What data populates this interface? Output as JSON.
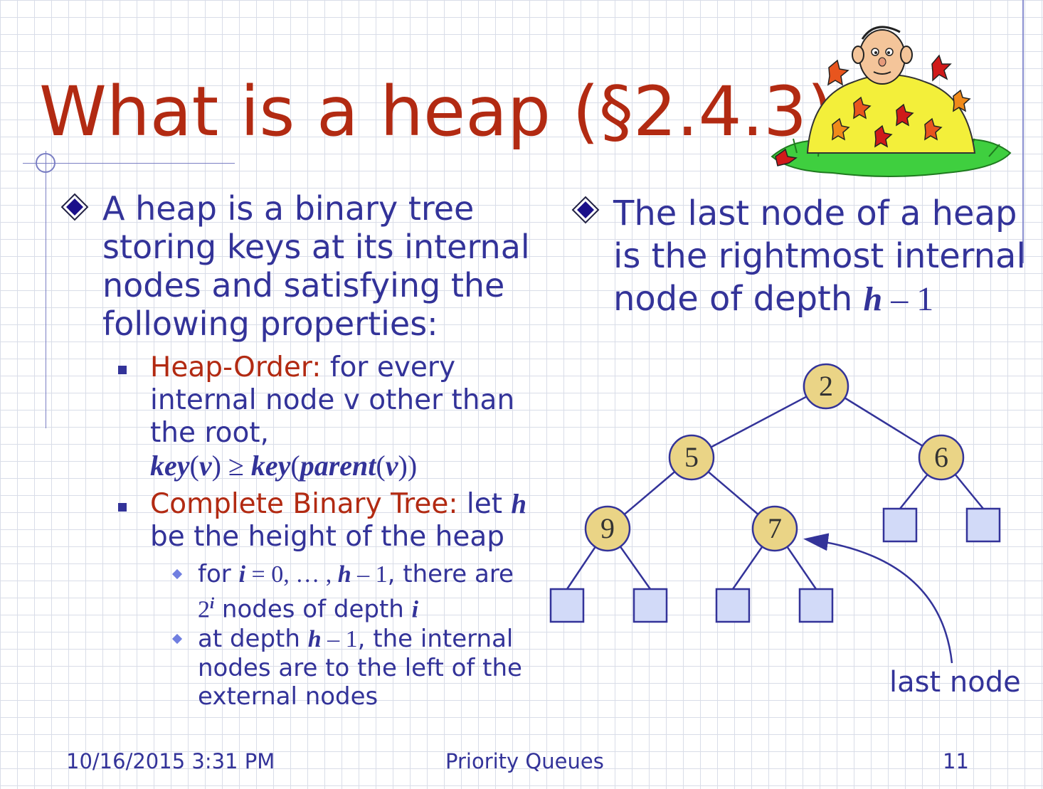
{
  "slide": {
    "title": "What is a heap (§2.4.3)"
  },
  "left": {
    "intro": [
      "A heap is a binary tree",
      "storing keys at its internal",
      "nodes and satisfying the",
      "following properties:"
    ],
    "heap_order": {
      "label": "Heap-Order:",
      "text_after_label": "for every",
      "line2": "internal node v other than",
      "line3": "the root,",
      "formula": {
        "key": "key",
        "lp": "(",
        "v": "v",
        "rp": ")",
        "geq": " ≥ ",
        "key2": "key",
        "lp2": "(",
        "parent": "parent",
        "lp3": "(",
        "v2": "v",
        "rp3": "))"
      }
    },
    "complete": {
      "label": "Complete Binary Tree:",
      "text_after_label": "let",
      "h": "h",
      "line2": "be the height of the heap",
      "sub1": {
        "for": "for",
        "i": "i",
        "eq": " = 0, … , ",
        "h": "h",
        "minus": " – 1",
        "rest": ", there are",
        "two": "2",
        "sup_i": "i",
        "line2_text": " nodes of depth ",
        "i2": "i"
      },
      "sub2": {
        "at_depth": "at depth ",
        "h": "h",
        "minus": " – 1",
        "rest": ", the internal",
        "line2": "nodes are to the left of the",
        "line3": "external nodes"
      }
    }
  },
  "right": {
    "line1": "The last node of a heap",
    "line2": "is the rightmost internal",
    "line3_text": "node of depth ",
    "h": "h",
    "minus": " – 1"
  },
  "tree": {
    "internal_nodes": [
      "2",
      "5",
      "6",
      "9",
      "7"
    ],
    "node_fill": "#ead486",
    "leaf_fill": "#d2daf8",
    "last_node_label": "last node"
  },
  "footer": {
    "date": "10/16/2015 3:31 PM",
    "center": "Priority Queues",
    "page": "11"
  },
  "colors": {
    "title": "#b22a12",
    "body_text": "#333399",
    "accent": "#b22a12",
    "grid": "#d9dde8"
  },
  "icons": {
    "bullet_level1": "diamond-bullet-icon",
    "bullet_level2": "square-bullet-icon",
    "bullet_level3": "small-diamond-bullet-icon",
    "clipart": "leaf-pile-clipart-icon"
  }
}
